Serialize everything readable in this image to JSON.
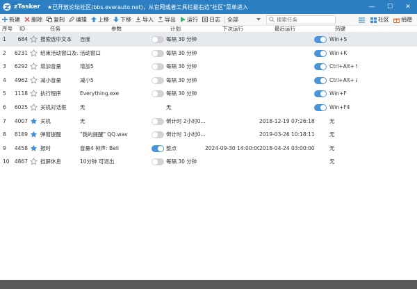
{
  "window": {
    "app_name": "zTasker",
    "notice": "★已开放论坛社区(bbs.everauto.net)，从官网或者工具栏最右边\"社区\"菜单进入",
    "minimize": "—",
    "maximize": "☐",
    "close": "✕"
  },
  "toolbar": {
    "new": "新建",
    "delete": "删除",
    "copy": "复制",
    "edit": "编辑",
    "move_up": "上移",
    "move_down": "下移",
    "import": "导入",
    "export": "导出",
    "run": "运行",
    "log": "日志",
    "scope": "全部",
    "search_placeholder": "搜索任务",
    "community": "社区",
    "donate": "捐赠"
  },
  "columns": {
    "no": "序号",
    "id": "ID",
    "task": "任务",
    "param": "参数",
    "plan": "计划",
    "next_run": "下次运行",
    "last_run": "最后运行",
    "hotkey": "热键"
  },
  "rows": [
    {
      "no": "1",
      "id": "684",
      "starred": false,
      "task": "搜索选中文本",
      "param": "百度",
      "enabled": false,
      "plan": "每隔 30 分钟",
      "next": "",
      "last": "",
      "hotkey_on": true,
      "hotkey": "Win+S"
    },
    {
      "no": "2",
      "id": "6231",
      "starred": false,
      "task": "结束活动窗口及...",
      "param": "活动窗口",
      "enabled": false,
      "plan": "每隔 30 分钟",
      "next": "",
      "last": "",
      "hotkey_on": true,
      "hotkey": "Win+K"
    },
    {
      "no": "3",
      "id": "6292",
      "starred": false,
      "task": "增加音量",
      "param": "增加5",
      "enabled": false,
      "plan": "每隔 30 分钟",
      "next": "",
      "last": "",
      "hotkey_on": true,
      "hotkey": "Ctrl+Alt+↑"
    },
    {
      "no": "4",
      "id": "4962",
      "starred": false,
      "task": "减小音量",
      "param": "减小5",
      "enabled": false,
      "plan": "每隔 30 分钟",
      "next": "",
      "last": "",
      "hotkey_on": true,
      "hotkey": "Ctrl+Alt+↓"
    },
    {
      "no": "5",
      "id": "1118",
      "starred": false,
      "task": "执行程序",
      "param": "Everything.exe",
      "enabled": false,
      "plan": "每隔 30 分钟",
      "next": "",
      "last": "",
      "hotkey_on": true,
      "hotkey": "Win+F"
    },
    {
      "no": "6",
      "id": "6025",
      "starred": false,
      "task": "关机对话框",
      "param": "无",
      "enabled": null,
      "plan": "无",
      "next": "",
      "last": "",
      "hotkey_on": true,
      "hotkey": "Win+F4"
    },
    {
      "no": "7",
      "id": "4007",
      "starred": true,
      "task": "关机",
      "param": "无",
      "enabled": false,
      "plan": "倒计时 2小时0...",
      "next": "",
      "last": "2018-12-19 07:26:18",
      "hotkey_on": null,
      "hotkey": "无"
    },
    {
      "no": "8",
      "id": "8189",
      "starred": true,
      "task": "弹窗提醒",
      "param": "\"我的提醒\" QQ.wav",
      "enabled": false,
      "plan": "倒计时 1小时0...",
      "next": "",
      "last": "2019-03-26 10:18:11",
      "hotkey_on": null,
      "hotkey": "无"
    },
    {
      "no": "9",
      "id": "4458",
      "starred": true,
      "task": "报时",
      "param": "音量4 钟声: Bell",
      "enabled": true,
      "plan": "整点",
      "next": "2024-09-30 14:00:00",
      "last": "2018-04-24 03:00:00",
      "hotkey_on": null,
      "hotkey": "无"
    },
    {
      "no": "10",
      "id": "4867",
      "starred": false,
      "task": "挡屏休息",
      "param": "10分钟 可退出",
      "enabled": false,
      "plan": "每隔 30 分钟",
      "next": "",
      "last": "",
      "hotkey_on": null,
      "hotkey": "无"
    }
  ],
  "colors": {
    "titlebar": "#2b7fc2",
    "accent": "#4a95d6",
    "star_filled": "#3d8fd8",
    "selected_row": "#e6e9ee"
  }
}
